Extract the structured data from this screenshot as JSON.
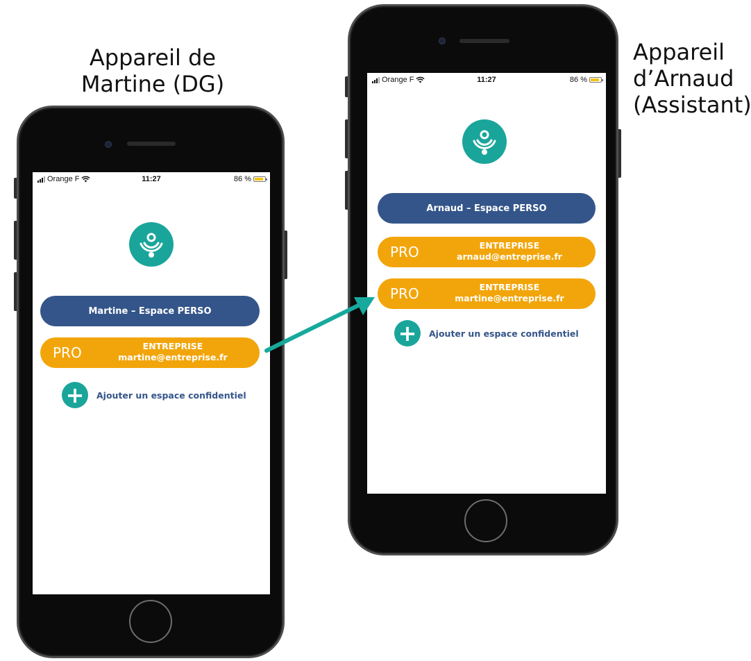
{
  "captions": {
    "left": [
      "Appareil de",
      "Martine (DG)"
    ],
    "right": [
      "Appareil",
      "d’Arnaud",
      "(Assistant)"
    ]
  },
  "colors": {
    "perso": "#34558a",
    "pro": "#f2a50a",
    "accent": "#1aa59b",
    "arrow": "#17a99e"
  },
  "left_phone": {
    "status": {
      "carrier": "Orange F",
      "time": "11:27",
      "battery": "86 %"
    },
    "logo_icon": "signal-drop-icon",
    "perso_label": "Martine – Espace PERSO",
    "pro_cards": [
      {
        "tag": "PRO",
        "title": "ENTREPRISE",
        "email": "martine@entreprise.fr"
      }
    ],
    "add_icon": "plus-icon",
    "add_label": "Ajouter un espace confidentiel"
  },
  "right_phone": {
    "status": {
      "carrier": "Orange F",
      "time": "11:27",
      "battery": "86 %"
    },
    "logo_icon": "signal-drop-icon",
    "perso_label": "Arnaud – Espace PERSO",
    "pro_cards": [
      {
        "tag": "PRO",
        "title": "ENTREPRISE",
        "email": "arnaud@entreprise.fr"
      },
      {
        "tag": "PRO",
        "title": "ENTREPRISE",
        "email": "martine@entreprise.fr"
      }
    ],
    "add_icon": "plus-icon",
    "add_label": "Ajouter un espace confidentiel"
  }
}
